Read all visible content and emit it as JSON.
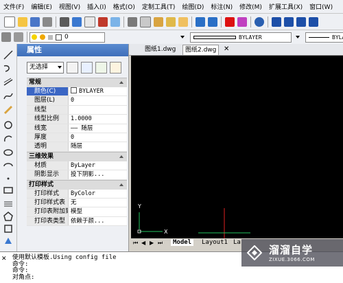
{
  "menu": [
    "文件(F)",
    "编辑(E)",
    "视图(V)",
    "插入(I)",
    "格式(O)",
    "定制工具(T)",
    "绘图(D)",
    "标注(N)",
    "修改(M)",
    "扩展工具(X)",
    "窗口(W)"
  ],
  "toolbar": {
    "layer_value": "0",
    "linetype_value": "BYLAYER",
    "lineweight_value": "BYLAYER"
  },
  "properties": {
    "title": "属性",
    "selection": "无选择",
    "sections": [
      {
        "title": "常规",
        "rows": [
          {
            "key": "颜色(C)",
            "value": "BYLAYER"
          },
          {
            "key": "图层(L)",
            "value": "0"
          },
          {
            "key": "线型",
            "value": ""
          },
          {
            "key": "线型比例",
            "value": "1.0000"
          },
          {
            "key": "线宽",
            "value": "—— 随层"
          },
          {
            "key": "厚度",
            "value": "0"
          },
          {
            "key": "透明",
            "value": "随层"
          }
        ]
      },
      {
        "title": "三维效果",
        "rows": [
          {
            "key": "材质",
            "value": "ByLayer"
          },
          {
            "key": "阴影显示",
            "value": "投下阴影..."
          }
        ]
      },
      {
        "title": "打印样式",
        "rows": [
          {
            "key": "打印样式",
            "value": "ByColor"
          },
          {
            "key": "打印样式表",
            "value": "无"
          },
          {
            "key": "打印表附加到",
            "value": "模型"
          },
          {
            "key": "打印表类型",
            "value": "依赖于颜..."
          }
        ]
      }
    ]
  },
  "doc_tabs": [
    "图纸1.dwg",
    "图纸2.dwg"
  ],
  "layout_tabs": [
    "Model",
    "Layout1",
    "La"
  ],
  "ucs": {
    "x_label": "X",
    "y_label": "Y"
  },
  "command_lines": [
    "使用默认模板.Using config file",
    "命令:",
    "命令:",
    "对角点:"
  ],
  "watermark": {
    "name": "溜溜自学",
    "url": "ZIXUE.3066.COM"
  },
  "colors": {
    "canvas": "#000000",
    "title_blue": "#3f6fba",
    "selection_blue": "#3b66c4",
    "ucs_green": "#22c55e",
    "axis_red": "#e02020"
  }
}
